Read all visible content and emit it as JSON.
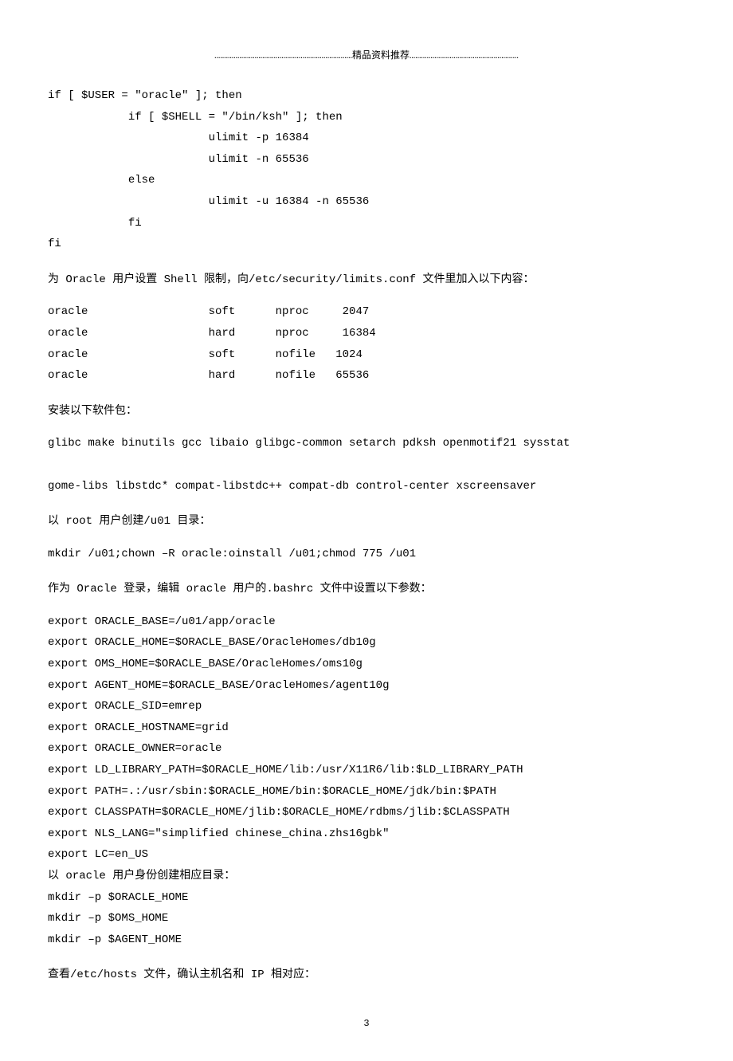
{
  "header": "………………………………………………………………精品资料推荐…………………………………………………",
  "block1": "if [ $USER = \"oracle\" ]; then\n            if [ $SHELL = \"/bin/ksh\" ]; then\n                        ulimit -p 16384\n                        ulimit -n 65536\n            else\n                        ulimit -u 16384 -n 65536\n            fi\nfi",
  "para1": "为 Oracle 用户设置 Shell 限制，向/etc/security/limits.conf 文件里加入以下内容：",
  "block2": "oracle                  soft      nproc     2047\noracle                  hard      nproc     16384\noracle                  soft      nofile   1024\noracle                  hard      nofile   65536",
  "para2": "安装以下软件包：",
  "block3": "glibc make binutils gcc libaio glibgc-common setarch pdksh openmotif21 sysstat\n\ngome-libs libstdc* compat-libstdc++ compat-db control-center xscreensaver",
  "para3": "以 root 用户创建/u01 目录：",
  "block4": "mkdir /u01;chown –R oracle:oinstall /u01;chmod 775 /u01",
  "para4": "作为 Oracle 登录，编辑 oracle 用户的.bashrc 文件中设置以下参数：",
  "block5": "export ORACLE_BASE=/u01/app/oracle\nexport ORACLE_HOME=$ORACLE_BASE/OracleHomes/db10g\nexport OMS_HOME=$ORACLE_BASE/OracleHomes/oms10g\nexport AGENT_HOME=$ORACLE_BASE/OracleHomes/agent10g\nexport ORACLE_SID=emrep\nexport ORACLE_HOSTNAME=grid\nexport ORACLE_OWNER=oracle\nexport LD_LIBRARY_PATH=$ORACLE_HOME/lib:/usr/X11R6/lib:$LD_LIBRARY_PATH\nexport PATH=.:/usr/sbin:$ORACLE_HOME/bin:$ORACLE_HOME/jdk/bin:$PATH\nexport CLASSPATH=$ORACLE_HOME/jlib:$ORACLE_HOME/rdbms/jlib:$CLASSPATH\nexport NLS_LANG=\"simplified chinese_china.zhs16gbk\"\nexport LC=en_US\n以 oracle 用户身份创建相应目录：\nmkdir –p $ORACLE_HOME\nmkdir –p $OMS_HOME\nmkdir –p $AGENT_HOME",
  "para5": "查看/etc/hosts 文件，确认主机名和 IP 相对应：",
  "page_number": "3"
}
